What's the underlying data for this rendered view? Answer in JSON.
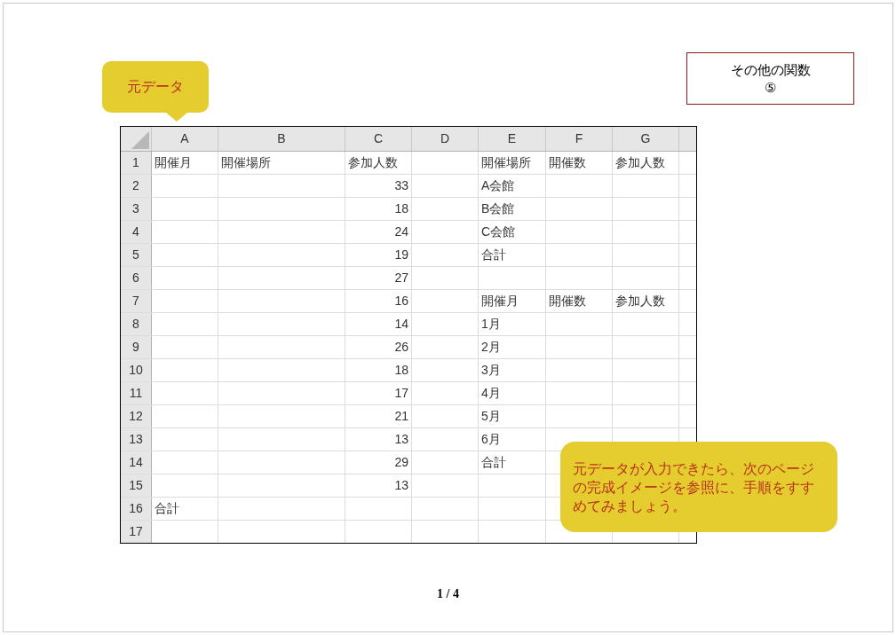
{
  "callout_top": {
    "text": "元データ"
  },
  "title_box": {
    "lines": [
      "その他の関数",
      "⑤"
    ]
  },
  "sheet": {
    "columns": [
      "A",
      "B",
      "C",
      "D",
      "E",
      "F",
      "G"
    ],
    "rows": [
      {
        "number": "1",
        "cells": [
          {
            "text": "開催月",
            "kind": "text"
          },
          {
            "text": "開催場所",
            "kind": "text"
          },
          {
            "text": "参加人数",
            "kind": "text"
          },
          null,
          {
            "text": "開催場所",
            "kind": "text"
          },
          {
            "text": "開催数",
            "kind": "text"
          },
          {
            "text": "参加人数",
            "kind": "text"
          }
        ]
      },
      {
        "number": "2",
        "cells": [
          null,
          null,
          {
            "text": "33",
            "kind": "number"
          },
          null,
          {
            "text": "A会館",
            "kind": "text"
          },
          null,
          null
        ]
      },
      {
        "number": "3",
        "cells": [
          null,
          null,
          {
            "text": "18",
            "kind": "number"
          },
          null,
          {
            "text": "B会館",
            "kind": "text"
          },
          null,
          null
        ]
      },
      {
        "number": "4",
        "cells": [
          null,
          null,
          {
            "text": "24",
            "kind": "number"
          },
          null,
          {
            "text": "C会館",
            "kind": "text"
          },
          null,
          null
        ]
      },
      {
        "number": "5",
        "cells": [
          null,
          null,
          {
            "text": "19",
            "kind": "number"
          },
          null,
          {
            "text": "合計",
            "kind": "text"
          },
          null,
          null
        ]
      },
      {
        "number": "6",
        "cells": [
          null,
          null,
          {
            "text": "27",
            "kind": "number"
          },
          null,
          null,
          null,
          null
        ]
      },
      {
        "number": "7",
        "cells": [
          null,
          null,
          {
            "text": "16",
            "kind": "number"
          },
          null,
          {
            "text": "開催月",
            "kind": "text"
          },
          {
            "text": "開催数",
            "kind": "text"
          },
          {
            "text": "参加人数",
            "kind": "text"
          }
        ]
      },
      {
        "number": "8",
        "cells": [
          null,
          null,
          {
            "text": "14",
            "kind": "number"
          },
          null,
          {
            "text": "1月",
            "kind": "text"
          },
          null,
          null
        ]
      },
      {
        "number": "9",
        "cells": [
          null,
          null,
          {
            "text": "26",
            "kind": "number"
          },
          null,
          {
            "text": "2月",
            "kind": "text"
          },
          null,
          null
        ]
      },
      {
        "number": "10",
        "cells": [
          null,
          null,
          {
            "text": "18",
            "kind": "number"
          },
          null,
          {
            "text": "3月",
            "kind": "text"
          },
          null,
          null
        ]
      },
      {
        "number": "11",
        "cells": [
          null,
          null,
          {
            "text": "17",
            "kind": "number"
          },
          null,
          {
            "text": "4月",
            "kind": "text"
          },
          null,
          null
        ]
      },
      {
        "number": "12",
        "cells": [
          null,
          null,
          {
            "text": "21",
            "kind": "number"
          },
          null,
          {
            "text": "5月",
            "kind": "text"
          },
          null,
          null
        ]
      },
      {
        "number": "13",
        "cells": [
          null,
          null,
          {
            "text": "13",
            "kind": "number"
          },
          null,
          {
            "text": "6月",
            "kind": "text"
          },
          null,
          null
        ]
      },
      {
        "number": "14",
        "cells": [
          null,
          null,
          {
            "text": "29",
            "kind": "number"
          },
          null,
          {
            "text": "合計",
            "kind": "text"
          },
          null,
          null
        ]
      },
      {
        "number": "15",
        "cells": [
          null,
          null,
          {
            "text": "13",
            "kind": "number"
          },
          null,
          null,
          null,
          null
        ]
      },
      {
        "number": "16",
        "cells": [
          {
            "text": "合計",
            "kind": "text"
          },
          null,
          null,
          null,
          null,
          null,
          null
        ]
      },
      {
        "number": "17",
        "cells": [
          null,
          null,
          null,
          null,
          null,
          null,
          null
        ]
      }
    ]
  },
  "callout_bottom": {
    "text": "元データが入力できたら、次のページの完成イメージを参照に、手順をすすめてみましょう。"
  },
  "page_indicator": "1 / 4"
}
